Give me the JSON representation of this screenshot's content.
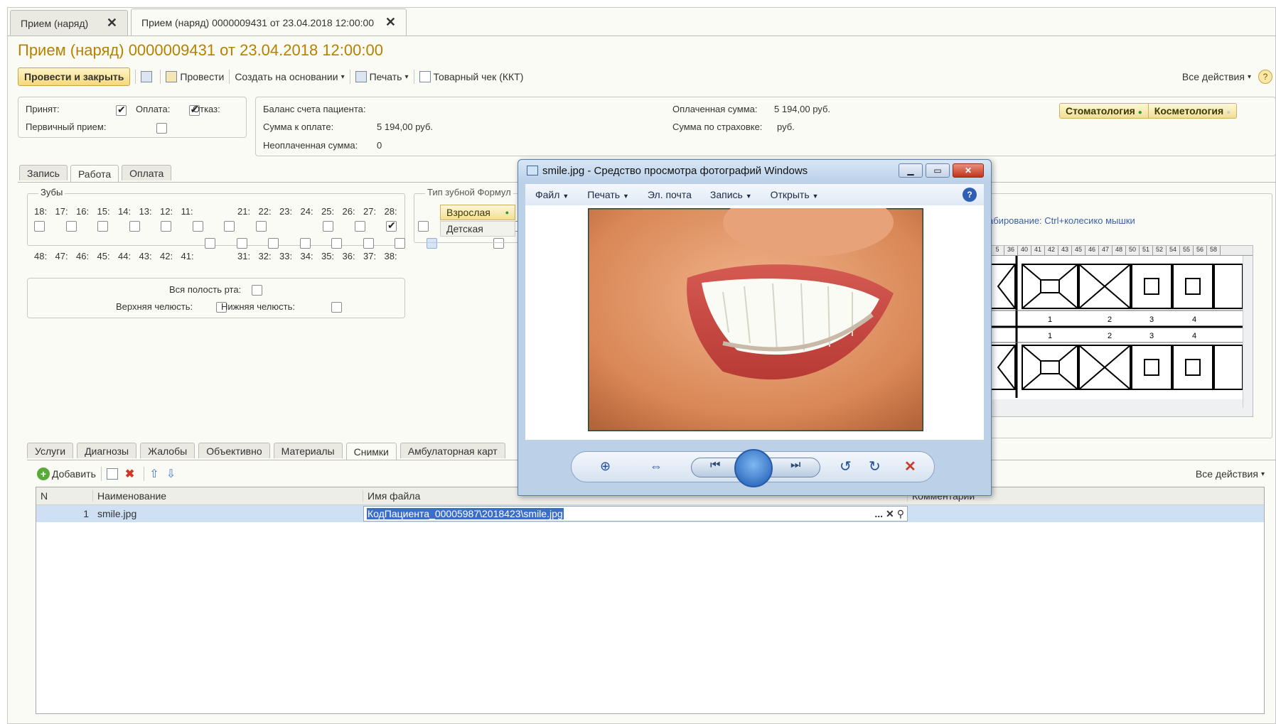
{
  "tabs": [
    {
      "label": "Прием (наряд)"
    },
    {
      "label": "Прием (наряд) 0000009431 от 23.04.2018 12:00:00"
    }
  ],
  "title": "Прием (наряд) 0000009431 от 23.04.2018 12:00:00",
  "toolbar": {
    "post_close": "Провести и закрыть",
    "post": "Провести",
    "create_basis": "Создать на основании",
    "print": "Печать",
    "receipt": "Товарный чек (ККТ)",
    "all_actions": "Все действия"
  },
  "status": {
    "accepted": "Принят:",
    "payment": "Оплата:",
    "refusal": "Отказ:",
    "primary": "Первичный прием:"
  },
  "balance": {
    "balance_label": "Баланс счета пациента:",
    "due_label": "Сумма к оплате:",
    "due_value": "5 194,00 руб.",
    "unpaid_label": "Неоплаченная сумма:",
    "unpaid_value": "0",
    "paid_label": "Оплаченная сумма:",
    "paid_value": "5 194,00 руб.",
    "insurance_label": "Сумма по страховке:",
    "insurance_value": "руб."
  },
  "specialties": [
    "Стоматология",
    "Косметология"
  ],
  "section_tabs": [
    "Запись",
    "Работа",
    "Оплата"
  ],
  "teeth": {
    "legend": "Зубы",
    "upper_left": [
      "18:",
      "17:",
      "16:",
      "15:",
      "14:",
      "13:",
      "12:",
      "11:"
    ],
    "upper_right": [
      "21:",
      "22:",
      "23:",
      "24:",
      "25:",
      "26:",
      "27:",
      "28:"
    ],
    "lower_left": [
      "48:",
      "47:",
      "46:",
      "45:",
      "44:",
      "43:",
      "42:",
      "41:"
    ],
    "lower_right": [
      "31:",
      "32:",
      "33:",
      "34:",
      "35:",
      "36:",
      "37:",
      "38:"
    ]
  },
  "areas": {
    "whole": "Вся полость рта:",
    "upper_jaw": "Верхняя челюсть:",
    "lower_jaw": "Нижняя челюсть:"
  },
  "formula": {
    "legend": "Тип зубной Формул",
    "adult": "Взрослая",
    "child": "Детская",
    "zoom_hint": "абирование: Ctrl+колесико мышки",
    "columns": [
      "5",
      "36",
      "40",
      "41",
      "42",
      "43",
      "45",
      "46",
      "47",
      "48",
      "50",
      "51",
      "52",
      "54",
      "55",
      "56",
      "58"
    ],
    "row_numbers": [
      "1",
      "2",
      "3",
      "4"
    ]
  },
  "bottom_tabs": [
    "Услуги",
    "Диагнозы",
    "Жалобы",
    "Объективно",
    "Материалы",
    "Снимки",
    "Амбулаторная карт"
  ],
  "grid": {
    "add": "Добавить",
    "all_actions": "Все действия",
    "columns": [
      "N",
      "Наименование",
      "Имя файла",
      "Комментарий"
    ],
    "rows": [
      {
        "n": "1",
        "name": "smile.jpg",
        "file": "КодПациента_00005987\\2018423\\smile.jpg",
        "comment": ""
      }
    ]
  },
  "viewer": {
    "title": "smile.jpg - Средство просмотра фотографий Windows",
    "menu": [
      "Файл",
      "Печать",
      "Эл. почта",
      "Запись",
      "Открыть"
    ]
  }
}
